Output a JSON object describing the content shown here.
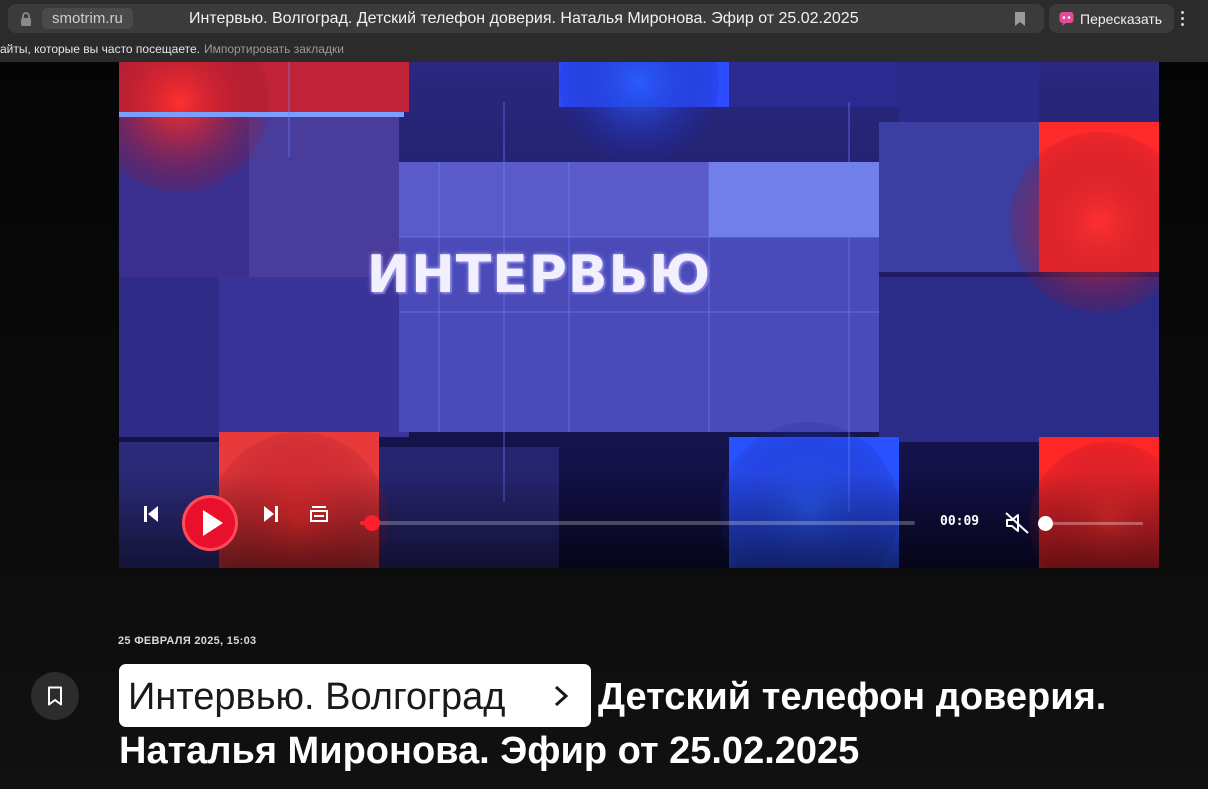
{
  "browser": {
    "domain": "smotrim.ru",
    "tab_title": "Интервью. Волгоград. Детский телефон доверия. Наталья Миронова. Эфир от 25.02.2025",
    "retell_label": "Пересказать",
    "bookmarks_text": "айты, которые вы часто посещаете.",
    "bookmarks_link": "Импортировать закладки"
  },
  "player": {
    "logo_text": "ИНТЕРВЬЮ",
    "time": "00:09",
    "progress": 0.01,
    "volume": 0.0,
    "muted": true
  },
  "article": {
    "date": "25 ФЕВРАЛЯ 2025, 15:03",
    "breadcrumb": "Интервью. Волгоград",
    "title_line1": "Детский телефон доверия.",
    "title_line2": "Наталья Миронова. Эфир от 25.02.2025"
  },
  "colors": {
    "accent_red": "#e8102a",
    "chrome_bg": "#2b2b2b",
    "page_bg": "#000000"
  }
}
